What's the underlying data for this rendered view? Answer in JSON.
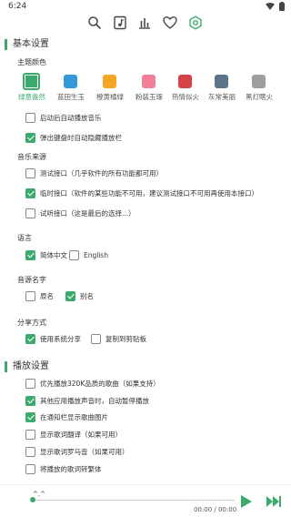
{
  "status_bar": {
    "time": "6:24"
  },
  "nav": {
    "icons": [
      "search-icon",
      "music-file-icon",
      "chart-icon",
      "heart-icon",
      "settings-icon"
    ],
    "active": "settings-icon"
  },
  "colors": {
    "accent": "#3daa6d"
  },
  "basic": {
    "title": "基本设置",
    "theme_label": "主题颜色",
    "themes": [
      {
        "label": "绿意盎然",
        "color": "#3daa6d",
        "active": true
      },
      {
        "label": "蓝田生玉",
        "color": "#3498db",
        "active": false
      },
      {
        "label": "橙黄橘绿",
        "color": "#f5a623",
        "active": false
      },
      {
        "label": "粉装玉琢",
        "color": "#f08098",
        "active": false
      },
      {
        "label": "热情似火",
        "color": "#d84148",
        "active": false
      },
      {
        "label": "灰常美丽",
        "color": "#5e7589",
        "active": false
      },
      {
        "label": "黑灯瞎火",
        "color": "#9e9e9e",
        "active": false
      }
    ],
    "options": [
      {
        "label": "启动后自动播放音乐",
        "checked": false
      },
      {
        "label": "弹出键盘时自动隐藏播放栏",
        "checked": true
      }
    ],
    "source_label": "音乐来源",
    "sources": [
      {
        "label": "测试接口（几乎软件的所有功能都可用）",
        "checked": false
      },
      {
        "label": "临时接口（软件的某些功能不可用，建议测试接口不可用再使用本接口）",
        "checked": true
      },
      {
        "label": "试听接口（这是最后的选择...）",
        "checked": false
      }
    ],
    "language_label": "语言",
    "languages": [
      {
        "label": "简体中文",
        "checked": true
      },
      {
        "label": "English",
        "checked": false
      }
    ],
    "source_name_label": "音源名字",
    "source_names": [
      {
        "label": "原名",
        "checked": false
      },
      {
        "label": "别名",
        "checked": true
      }
    ],
    "share_label": "分享方式",
    "shares": [
      {
        "label": "使用系统分享",
        "checked": true
      },
      {
        "label": "复制到剪贴板",
        "checked": false
      }
    ]
  },
  "playback": {
    "title": "播放设置",
    "options": [
      {
        "label": "优先播放320K品质的歌曲（如果支持）",
        "checked": false
      },
      {
        "label": "其他应用播放声音时，自动暂停播放",
        "checked": true
      },
      {
        "label": "在通知栏显示歌曲图片",
        "checked": true
      },
      {
        "label": "显示歌词翻译（如果可用）",
        "checked": false
      },
      {
        "label": "显示歌词罗马音（如果可用）",
        "checked": false
      },
      {
        "label": "将播放的歌词转繁体",
        "checked": false
      }
    ]
  },
  "player": {
    "title": "^.^",
    "time": "00:00 / 00:00",
    "progress": 0
  }
}
